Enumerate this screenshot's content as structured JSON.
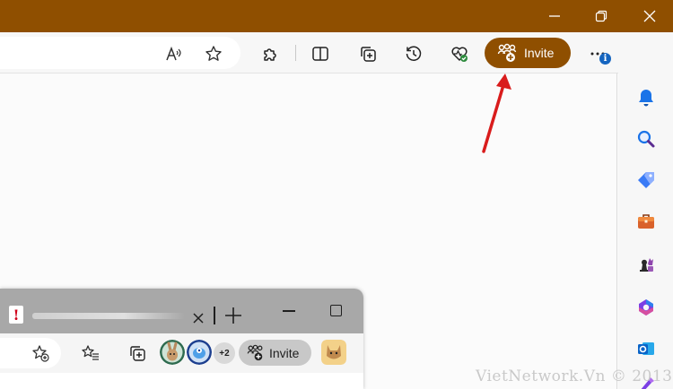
{
  "toolbar": {
    "invite_label": "Invite",
    "info_badge": "i",
    "icons": [
      "read-aloud-icon",
      "favorite-star-icon",
      "extensions-icon",
      "split-screen-icon",
      "collections-icon",
      "history-icon",
      "browser-essentials-icon",
      "invite-people-icon",
      "more-options-icon",
      "copilot-icon"
    ]
  },
  "sidebar": {
    "icons": [
      "notifications-bell-icon",
      "search-icon",
      "shopping-tag-icon",
      "tools-briefcase-icon",
      "games-chess-icon",
      "microsoft-365-icon",
      "outlook-icon",
      "designer-icon"
    ]
  },
  "inset": {
    "tab_favicon": "!",
    "plus_count": "+2",
    "invite_label": "Invite"
  },
  "colors": {
    "accent": "#8f4f00",
    "arrow": "#d91c1c",
    "badge": "#1565c0"
  },
  "watermark": "VietNetwork.Vn © 2013"
}
